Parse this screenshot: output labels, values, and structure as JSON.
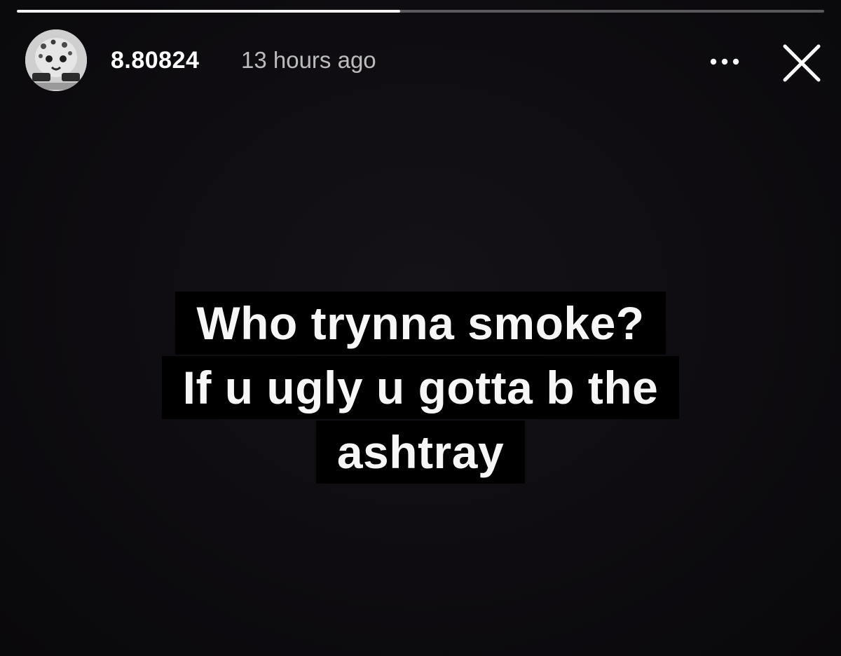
{
  "progress": {
    "fraction": 0.475
  },
  "header": {
    "username": "8.80824",
    "timestamp": "13 hours ago",
    "more_icon": "ellipsis-icon",
    "close_icon": "close-x-icon",
    "avatar_icon": "leopard-avatar"
  },
  "caption": {
    "lines": [
      "Who trynna smoke?",
      "If u ugly u gotta b the",
      "ashtray"
    ]
  },
  "colors": {
    "background": "#0d0b0e",
    "caption_bg": "#000000",
    "text": "#ffffff"
  }
}
